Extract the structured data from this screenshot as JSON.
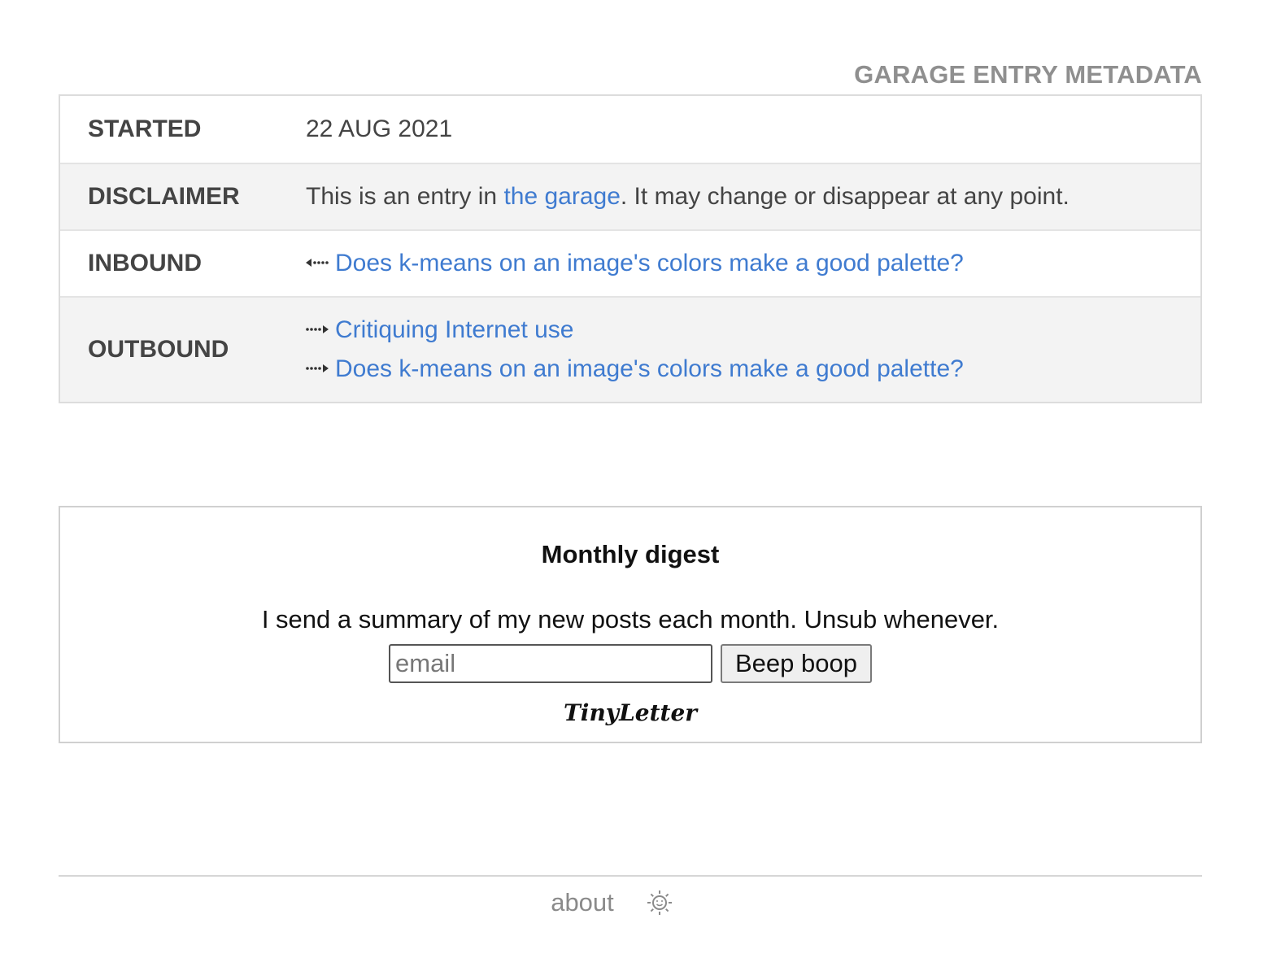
{
  "metadata": {
    "caption": "GARAGE ENTRY METADATA",
    "started": {
      "key": "STARTED",
      "value": "22 AUG 2021"
    },
    "disclaimer": {
      "key": "DISCLAIMER",
      "prefix": "This is an entry in ",
      "link": "the garage",
      "suffix": ". It may change or disappear at any point."
    },
    "inbound": {
      "key": "INBOUND",
      "arrow": "⇠",
      "links": [
        "Does k-means on an image's colors make a good palette?"
      ]
    },
    "outbound": {
      "key": "OUTBOUND",
      "arrow": "⇢",
      "links": [
        "Critiquing Internet use",
        "Does k-means on an image's colors make a good palette?"
      ]
    }
  },
  "digest": {
    "title": "Monthly digest",
    "text": "I send a summary of my new posts each month. Unsub whenever.",
    "email_placeholder": "email",
    "submit_label": "Beep boop",
    "provider": "TinyLetter"
  },
  "footer": {
    "about_label": "about",
    "theme_icon": "sun-icon"
  },
  "colors": {
    "link": "#3f7bd0",
    "caption": "#8f8f8f",
    "alt_row": "#f3f3f3",
    "footer_text": "#8a8a8a"
  }
}
